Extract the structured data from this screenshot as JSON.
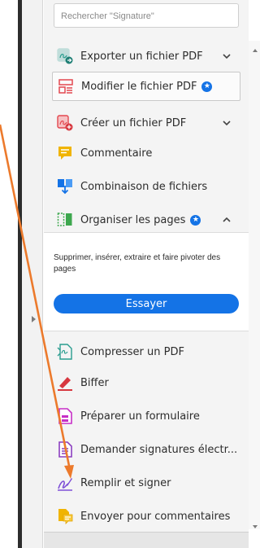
{
  "search": {
    "placeholder": "Rechercher \"Signature\""
  },
  "tools": [
    {
      "label": "Exporter un fichier PDF",
      "icon": "export-pdf-icon"
    },
    {
      "label": "Modifier le fichier PDF",
      "icon": "edit-pdf-icon",
      "badge": "premium-star"
    },
    {
      "label": "Créer un fichier PDF",
      "icon": "create-pdf-icon"
    },
    {
      "label": "Commentaire",
      "icon": "comment-icon"
    },
    {
      "label": "Combinaison de fichiers",
      "icon": "combine-files-icon"
    },
    {
      "label": "Organiser les pages",
      "icon": "organize-pages-icon",
      "badge": "premium-star"
    },
    {
      "label": "Compresser un PDF",
      "icon": "compress-pdf-icon"
    },
    {
      "label": "Biffer",
      "icon": "redact-icon"
    },
    {
      "label": "Préparer un formulaire",
      "icon": "prepare-form-icon"
    },
    {
      "label": "Demander signatures électr...",
      "icon": "request-signatures-icon"
    },
    {
      "label": "Remplir et signer",
      "icon": "fill-sign-icon"
    },
    {
      "label": "Envoyer pour commentaires",
      "icon": "send-for-comments-icon"
    }
  ],
  "organize_panel": {
    "description": "Supprimer, insérer, extraire et faire pivoter des pages",
    "try_label": "Essayer"
  },
  "colors": {
    "accent": "#1473e6",
    "annotation_arrow": "#ec7a2c"
  }
}
